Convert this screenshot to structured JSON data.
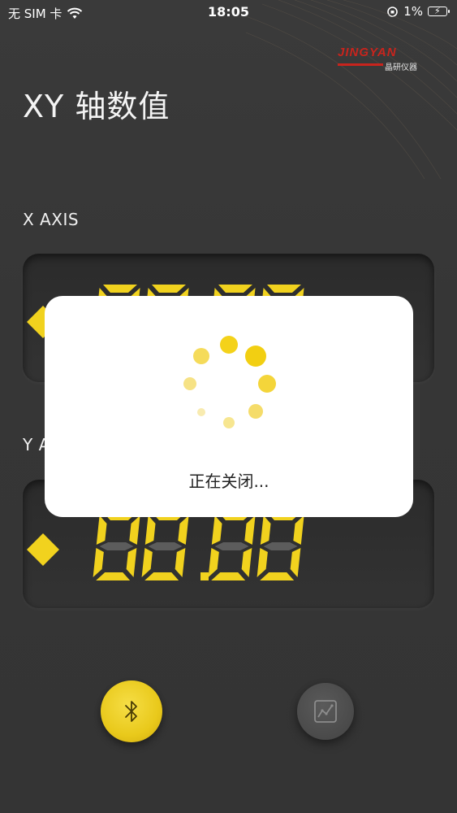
{
  "status_bar": {
    "carrier": "无 SIM 卡",
    "time": "18:05",
    "battery_percent": "1%"
  },
  "logo": {
    "brand": "JINGYAN",
    "brand_sub": "晶研仪器"
  },
  "page": {
    "title": "XY 轴数值"
  },
  "x_axis": {
    "label": "X AXIS",
    "display": "88.88"
  },
  "y_axis": {
    "label": "Y AXIS",
    "display": "88.88"
  },
  "modal": {
    "message": "正在关闭..."
  },
  "buttons": {
    "bluetooth_icon": "bluetooth-icon",
    "chart_icon": "chart-icon"
  },
  "colors": {
    "accent_yellow": "#f1d21e",
    "segment_off": "#5c5c5c",
    "background": "#363636",
    "brand_red": "#c8241d"
  }
}
